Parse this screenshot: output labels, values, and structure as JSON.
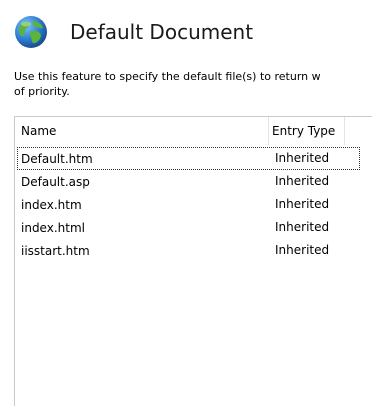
{
  "header": {
    "title": "Default Document",
    "icon": "globe-icon"
  },
  "description": "Use this feature to specify the default file(s) to return when a client does not request a specific file. Set default documents in order of priority.",
  "description_visible_line1": "Use this feature to specify the default file(s) to return w",
  "description_visible_line2": "of priority.",
  "list": {
    "columns": [
      "Name",
      "Entry Type"
    ],
    "rows": [
      {
        "name": "Default.htm",
        "type": "Inherited"
      },
      {
        "name": "Default.asp",
        "type": "Inherited"
      },
      {
        "name": "index.htm",
        "type": "Inherited"
      },
      {
        "name": "index.html",
        "type": "Inherited"
      },
      {
        "name": "iisstart.htm",
        "type": "Inherited"
      }
    ]
  },
  "colors": {
    "globe_blue": "#2f7fd3",
    "globe_green": "#5bb43c",
    "border": "#c9c9c9"
  }
}
